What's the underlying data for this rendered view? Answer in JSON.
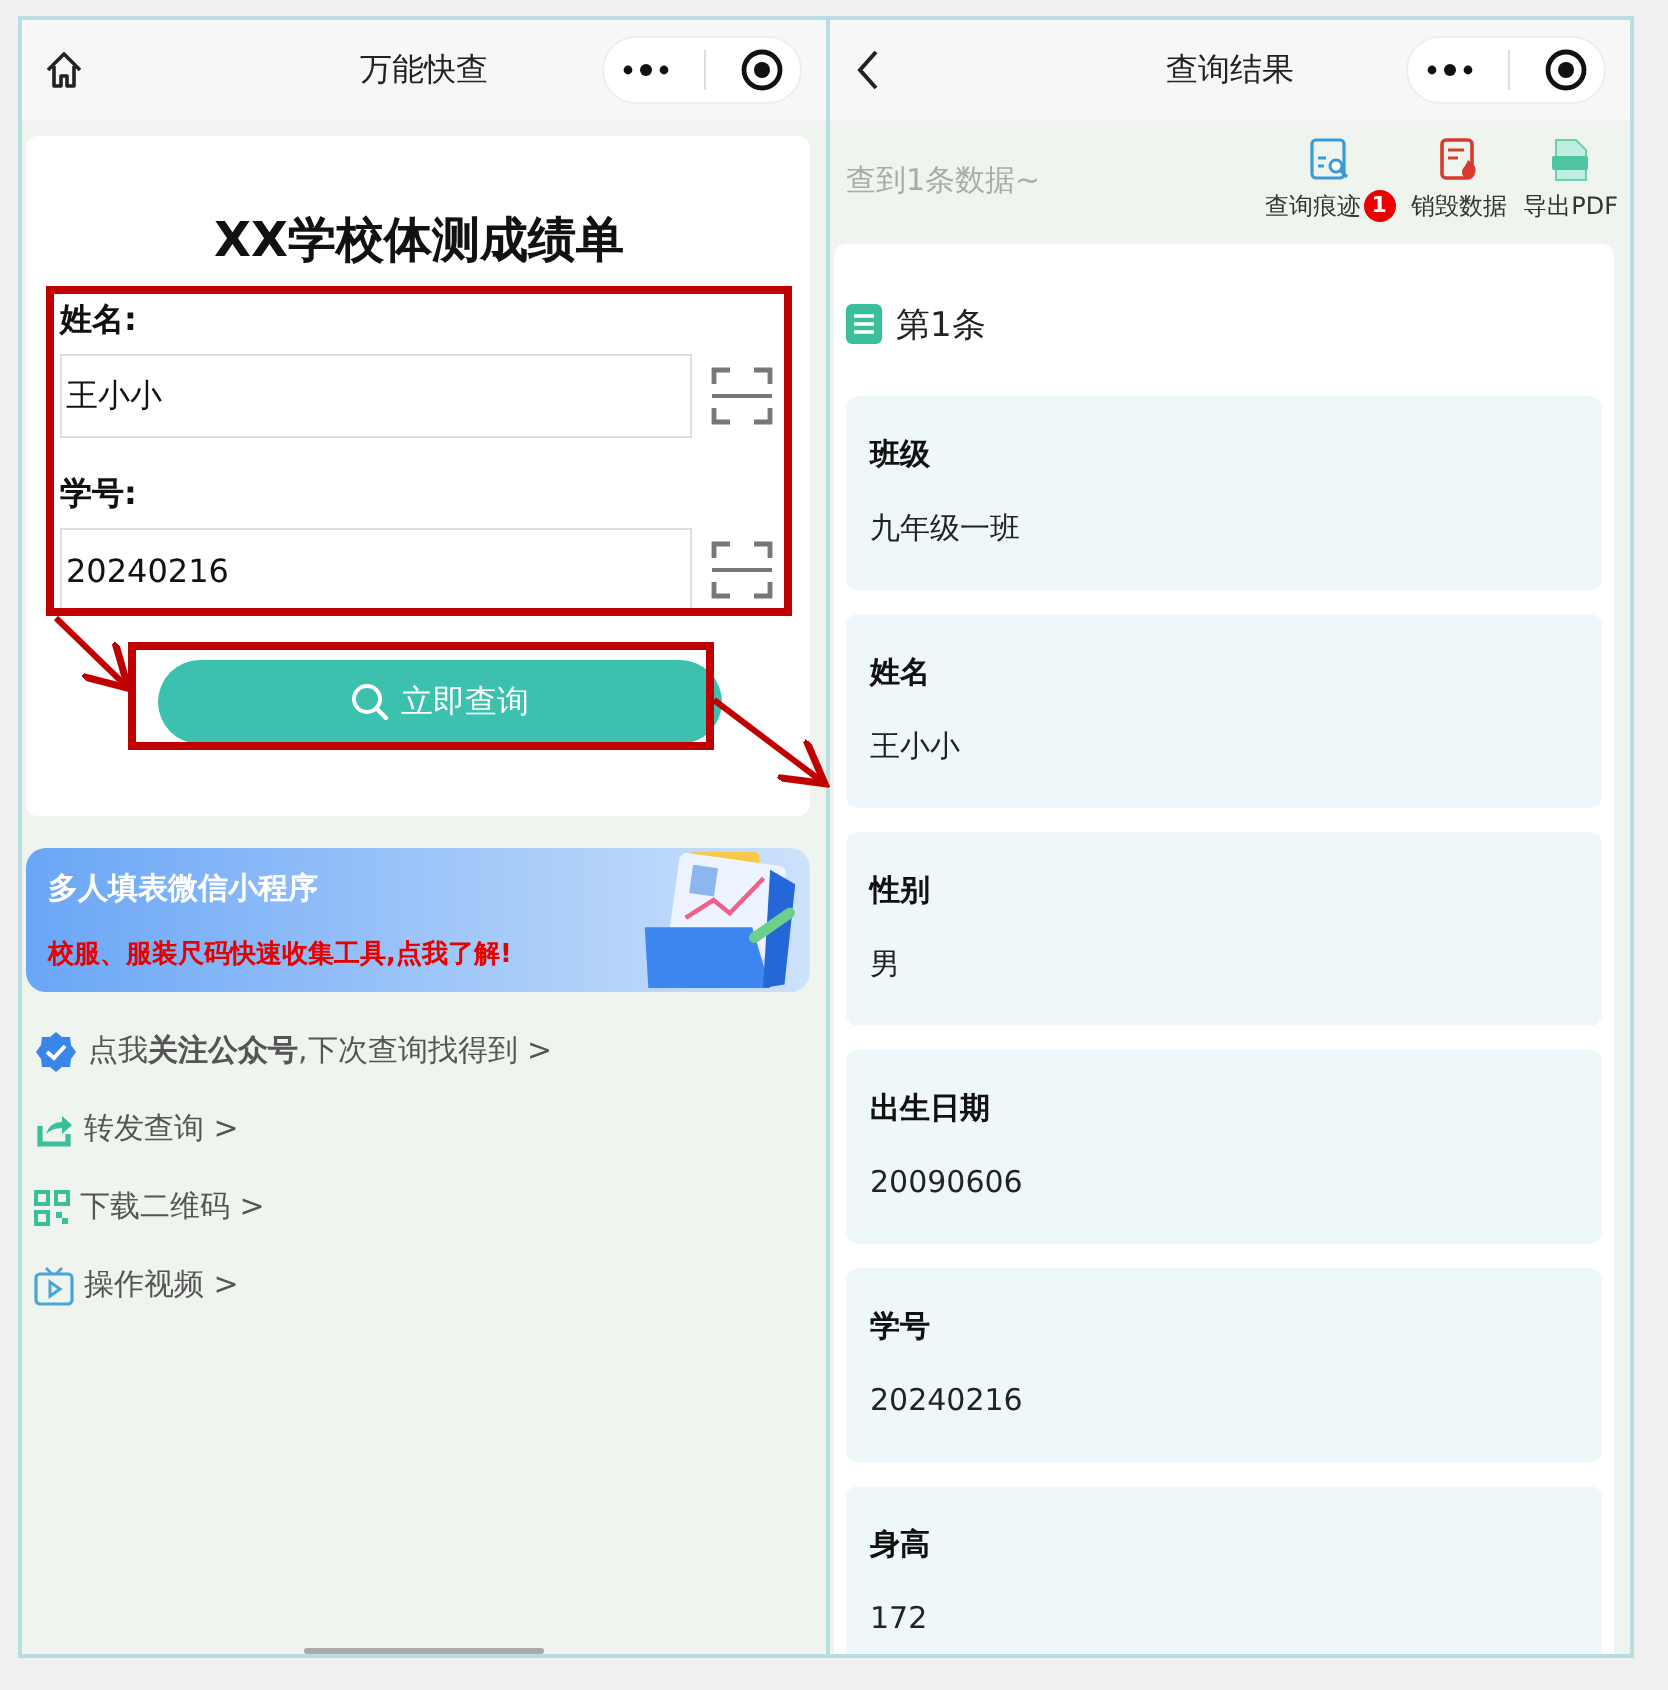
{
  "left": {
    "nav": {
      "title": "万能快查"
    },
    "form": {
      "title": "XX学校体测成绩单",
      "button": "立即查询",
      "fields": [
        {
          "label": "姓名:",
          "value": "王小小"
        },
        {
          "label": "学号:",
          "value": "20240216"
        }
      ]
    },
    "banner": {
      "title": "多人填表微信小程序",
      "subtitle": "校服、服装尺码快速收集工具,点我了解!"
    },
    "links": [
      {
        "kind": "follow",
        "text": "点我**关注公众号**,下次查询找得到 >"
      },
      {
        "kind": "share",
        "text": "转发查询 >"
      },
      {
        "kind": "qr",
        "text": "下载二维码 >"
      },
      {
        "kind": "video",
        "text": "操作视频 >"
      }
    ]
  },
  "right": {
    "nav": {
      "title": "查询结果"
    },
    "summary": "查到1条数据~",
    "actions": [
      {
        "kind": "history",
        "label": "查询痕迹",
        "badge": "1"
      },
      {
        "kind": "destroy",
        "label": "销毁数据"
      },
      {
        "kind": "pdf",
        "label": "导出PDF"
      }
    ],
    "record": {
      "title": "第1条",
      "fields": [
        {
          "label": "班级",
          "value": "九年级一班"
        },
        {
          "label": "姓名",
          "value": "王小小"
        },
        {
          "label": "性别",
          "value": "男"
        },
        {
          "label": "出生日期",
          "value": "20090606"
        },
        {
          "label": "学号",
          "value": "20240216"
        },
        {
          "label": "身高",
          "value": "172"
        }
      ]
    }
  }
}
